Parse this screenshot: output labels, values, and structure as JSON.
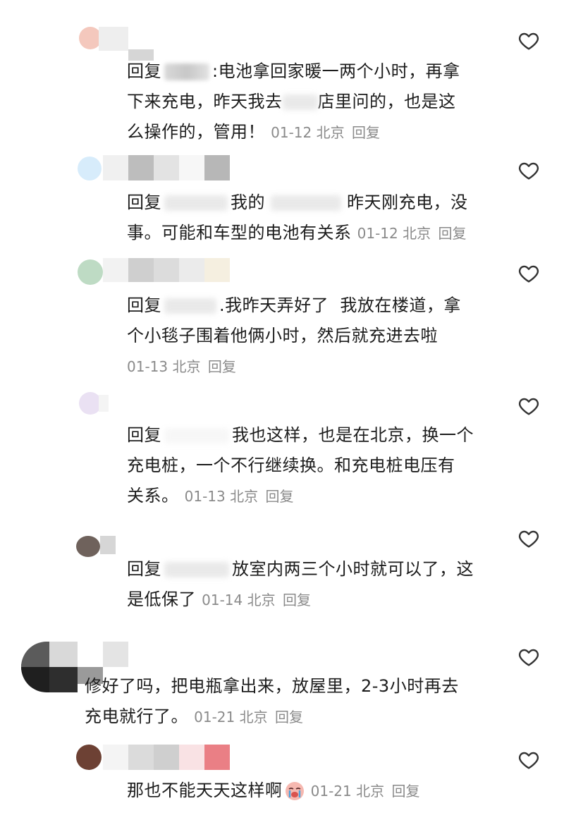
{
  "reply_prefix": "回复",
  "comments": [
    {
      "text_before": "电池拿回家暖一两个小时，再拿\n下来充电，昨天我去",
      "text_after": "店里问的，也是这\n么操作的，管用！",
      "date": "01-12",
      "location": "北京",
      "reply_label": "回复"
    },
    {
      "text_before": "我的",
      "text_after": "昨天刚充电，没\n事。可能和车型的电池有关系",
      "date": "01-12",
      "location": "北京",
      "reply_label": "回复"
    },
    {
      "text_before": "我昨天弄好了  我放在楼道，拿\n个小毯子围着他俩小时，然后就充进去啦",
      "date": "01-13",
      "location": "北京",
      "reply_label": "回复"
    },
    {
      "text_before": "我也这样，也是在北京，换一个\n充电桩，一个不行继续换。和充电桩电压有\n关系。",
      "date": "01-13",
      "location": "北京",
      "reply_label": "回复"
    },
    {
      "text_before": "放室内两三个小时就可以了，这\n是低保了",
      "date": "01-14",
      "location": "北京",
      "reply_label": "回复"
    },
    {
      "text_before": "修好了吗，把电瓶拿出来，放屋里，2-3小时再去\n充电就行了。",
      "date": "01-21",
      "location": "北京",
      "reply_label": "回复"
    },
    {
      "text_before": "那也不能天天这样啊",
      "emoji": "crying-face-emoji",
      "date": "01-21",
      "location": "北京",
      "reply_label": "回复"
    }
  ],
  "colors": {
    "text": "#1c1c1c",
    "meta": "#8a8a8a",
    "heart": "#333333"
  },
  "icons": {
    "like": "heart-outline-icon"
  }
}
